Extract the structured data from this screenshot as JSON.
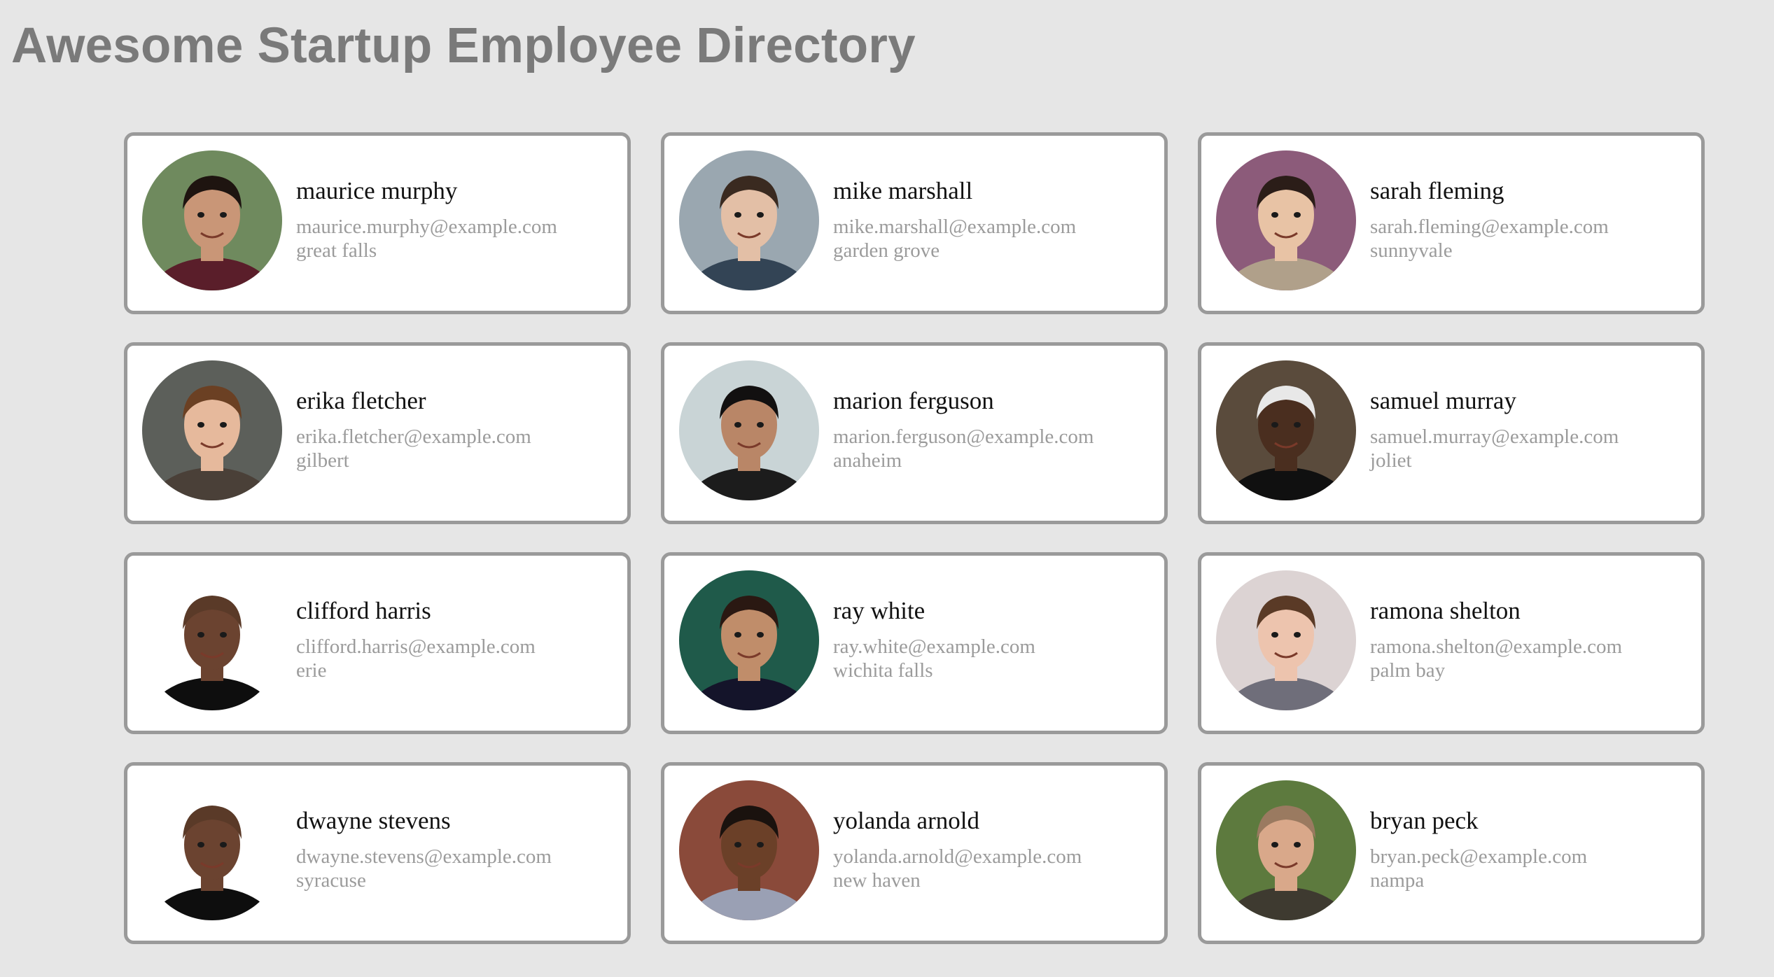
{
  "page": {
    "title": "Awesome Startup Employee Directory",
    "background": "#e6e6e6",
    "title_color": "#7a7a7a",
    "card_border_color": "#9a9a9a"
  },
  "employees": [
    {
      "name": "maurice murphy",
      "email": "maurice.murphy@example.com",
      "city": "great falls",
      "avatar": {
        "bg": "#6f8a5e",
        "skin": "#c99677",
        "hair": "#1e1410",
        "shirt": "#5a1e2a"
      }
    },
    {
      "name": "mike marshall",
      "email": "mike.marshall@example.com",
      "city": "garden grove",
      "avatar": {
        "bg": "#9aa7b0",
        "skin": "#e3bfa6",
        "hair": "#3a2a20",
        "shirt": "#334455"
      }
    },
    {
      "name": "sarah fleming",
      "email": "sarah.fleming@example.com",
      "city": "sunnyvale",
      "avatar": {
        "bg": "#8c5b7a",
        "skin": "#e8c3a5",
        "hair": "#2b1d18",
        "shirt": "#b0a08a"
      }
    },
    {
      "name": "erika fletcher",
      "email": "erika.fletcher@example.com",
      "city": "gilbert",
      "avatar": {
        "bg": "#5c5f5a",
        "skin": "#e6b99c",
        "hair": "#6b4023",
        "shirt": "#4a4038"
      }
    },
    {
      "name": "marion ferguson",
      "email": "marion.ferguson@example.com",
      "city": "anaheim",
      "avatar": {
        "bg": "#c9d4d6",
        "skin": "#b98667",
        "hair": "#121010",
        "shirt": "#1c1c1c"
      }
    },
    {
      "name": "samuel murray",
      "email": "samuel.murray@example.com",
      "city": "joliet",
      "avatar": {
        "bg": "#5a4b3c",
        "skin": "#4a2e1f",
        "hair": "#e8e8e8",
        "shirt": "#101010"
      }
    },
    {
      "name": "clifford harris",
      "email": "clifford.harris@example.com",
      "city": "erie",
      "avatar": {
        "bg": "#ffffff",
        "skin": "#6b4330",
        "hair": "#5a3a28",
        "shirt": "#0e0e0e"
      }
    },
    {
      "name": "ray white",
      "email": "ray.white@example.com",
      "city": "wichita falls",
      "avatar": {
        "bg": "#1f5a4a",
        "skin": "#c08d6a",
        "hair": "#2a1812",
        "shirt": "#14142a"
      }
    },
    {
      "name": "ramona shelton",
      "email": "ramona.shelton@example.com",
      "city": "palm bay",
      "avatar": {
        "bg": "#dcd3d3",
        "skin": "#edc4ae",
        "hair": "#5a3a26",
        "shirt": "#6f6e7a"
      }
    },
    {
      "name": "dwayne stevens",
      "email": "dwayne.stevens@example.com",
      "city": "syracuse",
      "avatar": {
        "bg": "#ffffff",
        "skin": "#6b4330",
        "hair": "#5a3a28",
        "shirt": "#0e0e0e"
      }
    },
    {
      "name": "yolanda arnold",
      "email": "yolanda.arnold@example.com",
      "city": "new haven",
      "avatar": {
        "bg": "#8a4a3a",
        "skin": "#6b4028",
        "hair": "#1a120e",
        "shirt": "#9aa0b4"
      }
    },
    {
      "name": "bryan peck",
      "email": "bryan.peck@example.com",
      "city": "nampa",
      "avatar": {
        "bg": "#5d7a3e",
        "skin": "#d9a88a",
        "hair": "#9a7a60",
        "shirt": "#3e3a30"
      }
    }
  ]
}
